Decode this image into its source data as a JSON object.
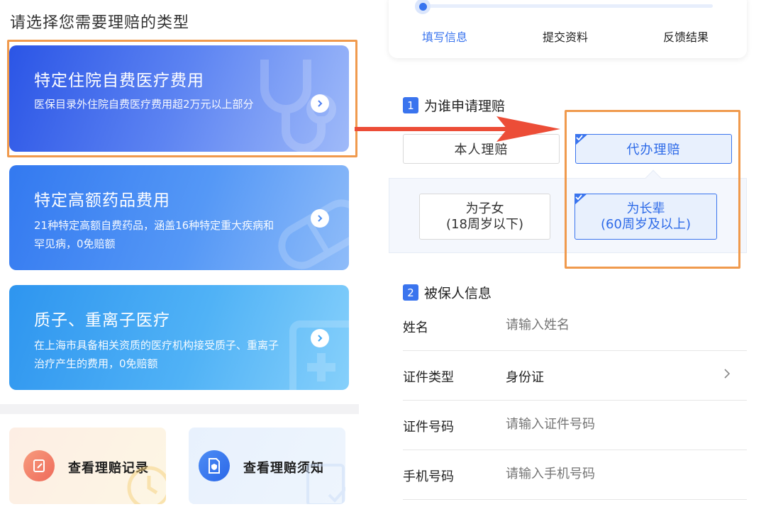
{
  "left": {
    "title": "请选择您需要理赔的类型",
    "cards": [
      {
        "title": "特定住院自费医疗费用",
        "desc": "医保目录外住院自费医疗费用超2万元以上部分",
        "icon": "stethoscope-icon"
      },
      {
        "title": "特定高额药品费用",
        "desc": "21种特定高额自费药品，涵盖16种特定重大疾病和罕见病，0免赔额",
        "icon": "pill-icon"
      },
      {
        "title": "质子、重离子医疗",
        "desc": "在上海市具备相关资质的医疗机构接受质子、重离子治疗产生的费用，0免赔额",
        "icon": "medical-document-icon"
      }
    ],
    "quick_links": [
      {
        "label": "查看理赔记录",
        "icon": "edit-record-icon"
      },
      {
        "label": "查看理赔须知",
        "icon": "shield-doc-icon"
      }
    ]
  },
  "right": {
    "steps": [
      "填写信息",
      "提交资料",
      "反馈结果"
    ],
    "active_step": 0,
    "section1": {
      "num": "1",
      "title": "为谁申请理赔"
    },
    "options": {
      "self": "本人理赔",
      "agent": "代办理赔",
      "selected": "agent"
    },
    "sub_options": {
      "kid_line1": "为子女",
      "kid_line2": "(18周岁以下)",
      "elder_line1": "为长辈",
      "elder_line2": "(60周岁及以上)",
      "selected": "elder"
    },
    "section2": {
      "num": "2",
      "title": "被保人信息"
    },
    "form": {
      "name_label": "姓名",
      "name_placeholder": "请输入姓名",
      "idtype_label": "证件类型",
      "idtype_value": "身份证",
      "idnum_label": "证件号码",
      "idnum_placeholder": "请输入证件号码",
      "phone_label": "手机号码",
      "phone_placeholder": "请输入手机号码"
    }
  },
  "colors": {
    "accent": "#3a74ee",
    "highlight": "#f09a4d",
    "arrow": "#ec4d37"
  }
}
